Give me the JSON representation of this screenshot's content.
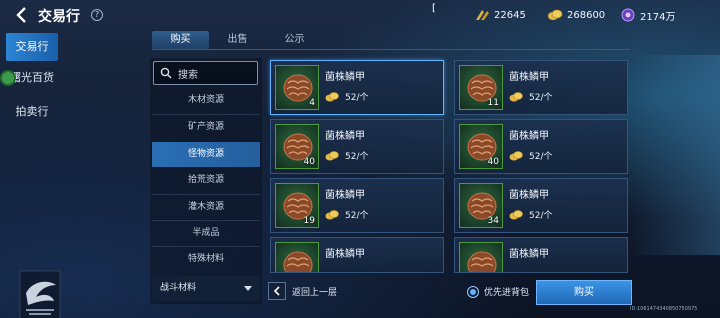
{
  "header": {
    "title": "交易行",
    "help_label": "?",
    "cursor_mark": "["
  },
  "currencies": [
    {
      "icon": "wheat-currency-icon",
      "value": "22645"
    },
    {
      "icon": "gold-coin-currency-icon",
      "value": "268600"
    },
    {
      "icon": "crystal-currency-icon",
      "value": "2174万"
    }
  ],
  "sidebar": {
    "items": [
      {
        "label": "交易行",
        "active": true
      },
      {
        "label": "曙光百货",
        "active": false
      },
      {
        "label": "拍卖行",
        "active": false
      }
    ]
  },
  "tabs": [
    {
      "label": "购买",
      "active": true
    },
    {
      "label": "出售",
      "active": false
    },
    {
      "label": "公示",
      "active": false
    }
  ],
  "search": {
    "placeholder": "搜索"
  },
  "categories": [
    {
      "label": "木材资源",
      "active": false
    },
    {
      "label": "矿产资源",
      "active": false
    },
    {
      "label": "怪物资源",
      "active": true
    },
    {
      "label": "拾荒资源",
      "active": false
    },
    {
      "label": "灌木资源",
      "active": false
    },
    {
      "label": "半成品",
      "active": false
    },
    {
      "label": "特殊材料",
      "active": false
    }
  ],
  "category_group": {
    "label": "战斗材料"
  },
  "items": [
    {
      "name": "菌株鳞甲",
      "qty": "4",
      "price": "52/个",
      "selected": true
    },
    {
      "name": "菌株鳞甲",
      "qty": "11",
      "price": "52/个",
      "selected": false
    },
    {
      "name": "菌株鳞甲",
      "qty": "40",
      "price": "52/个",
      "selected": false
    },
    {
      "name": "菌株鳞甲",
      "qty": "40",
      "price": "52/个",
      "selected": false
    },
    {
      "name": "菌株鳞甲",
      "qty": "19",
      "price": "52/个",
      "selected": false
    },
    {
      "name": "菌株鳞甲",
      "qty": "34",
      "price": "52/个",
      "selected": false
    },
    {
      "name": "菌株鳞甲",
      "qty": "",
      "price": "",
      "selected": false
    },
    {
      "name": "菌株鳞甲",
      "qty": "",
      "price": "",
      "selected": false
    }
  ],
  "footer": {
    "back_label": "返回上一层",
    "radio_label": "优先进背包",
    "buy_label": "购买",
    "uid": "ID:1061474340850750975"
  },
  "colors": {
    "accent": "#2c85d3",
    "selected_border": "#5fb4ff",
    "item_frame": "#4d9a3e"
  }
}
